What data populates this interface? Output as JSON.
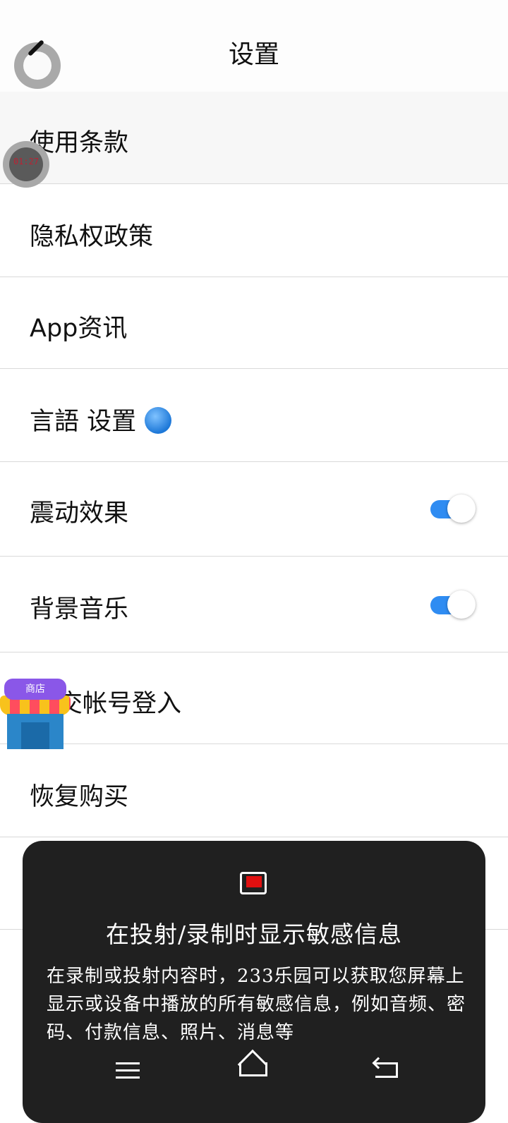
{
  "header": {
    "title": "设置"
  },
  "menu": {
    "items": [
      {
        "label": "使用条款"
      },
      {
        "label": "隐私权政策"
      },
      {
        "label": "App资讯"
      },
      {
        "label": "言語 设置"
      },
      {
        "label": "震动效果",
        "toggle_on": true
      },
      {
        "label": "背景音乐",
        "toggle_on": true
      },
      {
        "label": "交帐号登入"
      },
      {
        "label": "恢复购买"
      }
    ]
  },
  "overlays": {
    "floating_dot_text": "01:27",
    "shop_sign": "商店"
  },
  "dialog": {
    "title": "在投射/录制时显示敏感信息",
    "body": "在录制或投射内容时，233乐园可以获取您屏幕上显示或设备中播放的所有敏感信息，例如音频、密码、付款信息、照片、消息等"
  },
  "colors": {
    "toggle_on": "#2f8cf2",
    "dialog_bg": "#202020",
    "cast_accent": "#e01010"
  }
}
